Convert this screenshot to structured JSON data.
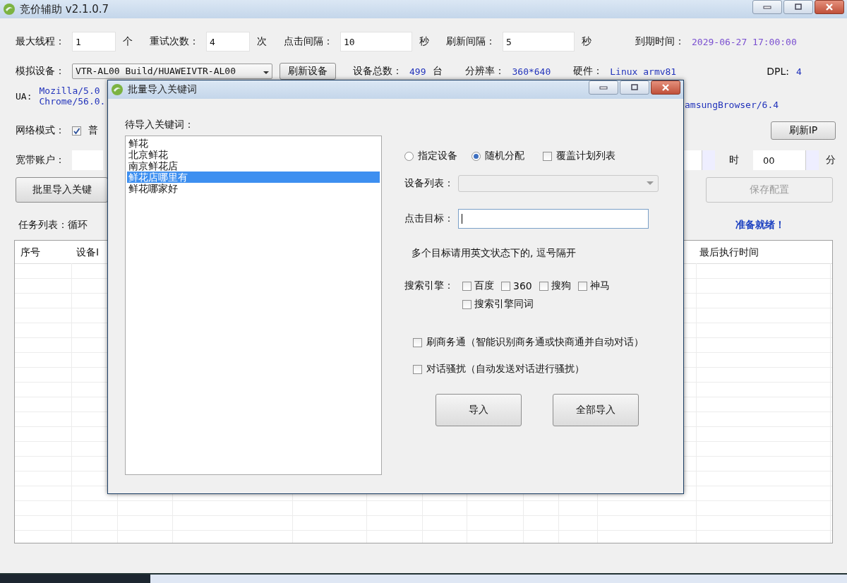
{
  "window": {
    "title": "竞价辅助 v2.1.0.7"
  },
  "settings": [
    {
      "label": "最大线程：",
      "value": "1",
      "unit": "个"
    },
    {
      "label": "重试次数：",
      "value": "4",
      "unit": "次"
    },
    {
      "label": "点击间隔：",
      "value": "10",
      "unit": "秒"
    },
    {
      "label": "刷新间隔：",
      "value": "5",
      "unit": "秒"
    }
  ],
  "expiry": {
    "label": "到期时间：",
    "value": "2029-06-27 17:00:00"
  },
  "device": {
    "label": "模拟设备：",
    "value": "VTR-AL00 Build/HUAWEIVTR-AL00",
    "button": "刷新设备",
    "stats": [
      {
        "label": "设备总数：",
        "value": "499",
        "unit": "台"
      },
      {
        "label": "分辨率：",
        "value": "360*640"
      },
      {
        "label": "硬件：",
        "value": "Linux armv81"
      },
      {
        "label": "DPL:",
        "value": "4"
      }
    ]
  },
  "ua": {
    "label": "UA:",
    "lines": [
      "Mozilla/5.0",
      "Chrome/56.0."
    ],
    "tail": "amsungBrowser/6.4"
  },
  "network": {
    "label": "网络模式：",
    "option": {
      "label": "普",
      "checked": true
    },
    "button": "刷新IP"
  },
  "broadband": {
    "label": "宽带账户：",
    "hour_unit": "时",
    "minute_value": "00",
    "minute_unit": "分"
  },
  "actions": {
    "import_button": "批里导入关键",
    "save_button": {
      "label": "保存配置",
      "disabled": true
    }
  },
  "tasks": {
    "label": "任务列表：循环",
    "status": "准备就绪！"
  },
  "table": {
    "columns": [
      {
        "label": "序号"
      },
      {
        "label": "设备I"
      },
      {
        "label": "最后执行时间"
      }
    ]
  },
  "dialog": {
    "title": "批量导入关键词",
    "list_label": "待导入关键词：",
    "keywords": [
      {
        "text": "鲜花",
        "selected": false
      },
      {
        "text": "北京鲜花",
        "selected": false
      },
      {
        "text": "南京鲜花店",
        "selected": false
      },
      {
        "text": "鲜花店哪里有",
        "selected": true
      },
      {
        "text": "鲜花哪家好",
        "selected": false
      }
    ],
    "modes": [
      {
        "label": "指定设备",
        "selected": false
      },
      {
        "label": "随机分配",
        "selected": true
      }
    ],
    "overwrite": {
      "label": "覆盖计划列表",
      "checked": false
    },
    "device_list": {
      "label": "设备列表：",
      "disabled": true
    },
    "target": {
      "label": "点击目标："
    },
    "hint": "多个目标请用英文状态下的, 逗号隔开",
    "engines": {
      "label": "搜索引擎：",
      "options": [
        {
          "label": "百度",
          "checked": false
        },
        {
          "label": "360",
          "checked": false
        },
        {
          "label": "搜狗",
          "checked": false
        },
        {
          "label": "神马",
          "checked": false
        },
        {
          "label": "搜索引擎同词",
          "checked": false
        }
      ]
    },
    "extras": [
      {
        "label": "刷商务通（智能识别商务通或快商通并自动对话）",
        "checked": false
      },
      {
        "label": "对话骚扰（自动发送对话进行骚扰）",
        "checked": false
      }
    ],
    "buttons": [
      "导入",
      "全部导入"
    ]
  }
}
